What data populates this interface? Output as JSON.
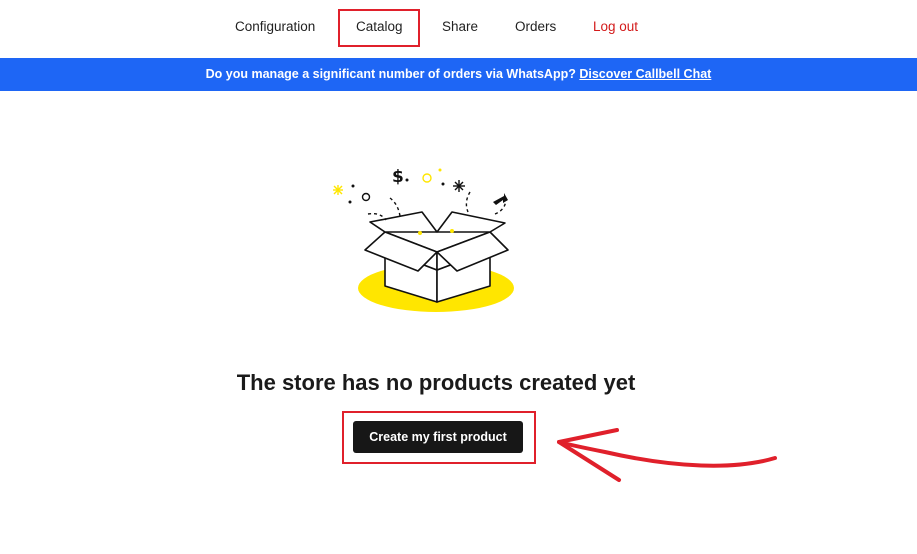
{
  "nav": {
    "items": [
      {
        "label": "Configuration"
      },
      {
        "label": "Catalog"
      },
      {
        "label": "Share"
      },
      {
        "label": "Orders"
      },
      {
        "label": "Log out"
      }
    ],
    "active": "Catalog"
  },
  "banner": {
    "text": "Do you manage a significant number of orders via WhatsApp?",
    "link": "Discover Callbell Chat"
  },
  "empty_state": {
    "title": "The store has no products created yet",
    "button_label": "Create my first product",
    "illustration": "open-box-icon"
  },
  "colors": {
    "banner": "#1e66f5",
    "highlight": "#e0202b",
    "logout": "#d31a1a",
    "button": "#171717",
    "accent_yellow": "#ffe600"
  }
}
